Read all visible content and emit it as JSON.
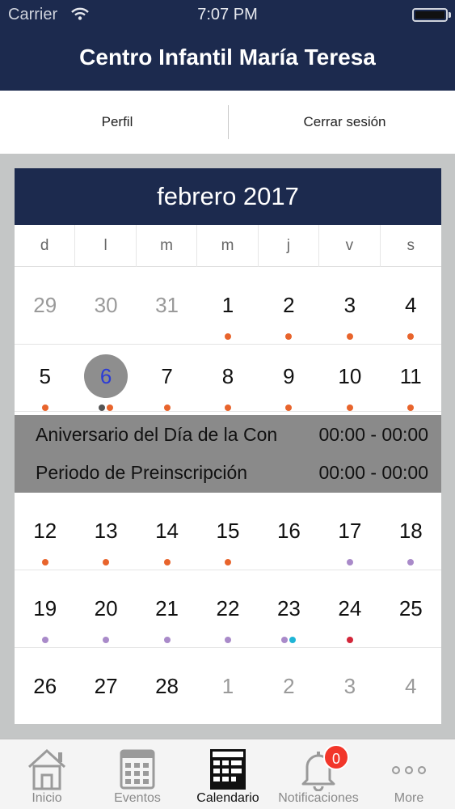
{
  "status_bar": {
    "carrier": "Carrier",
    "time": "7:07 PM"
  },
  "header": {
    "title": "Centro Infantil María Teresa"
  },
  "subnav": {
    "profile_label": "Perfil",
    "logout_label": "Cerrar sesión"
  },
  "calendar": {
    "month_title": "febrero 2017",
    "weekdays": [
      "d",
      "l",
      "m",
      "m",
      "j",
      "v",
      "s"
    ],
    "weeks": [
      [
        {
          "d": "29",
          "other": true,
          "dots": []
        },
        {
          "d": "30",
          "other": true,
          "dots": []
        },
        {
          "d": "31",
          "other": true,
          "dots": []
        },
        {
          "d": "1",
          "dots": [
            "#e8642c"
          ]
        },
        {
          "d": "2",
          "dots": [
            "#e8642c"
          ]
        },
        {
          "d": "3",
          "dots": [
            "#e8642c"
          ]
        },
        {
          "d": "4",
          "dots": [
            "#e8642c"
          ]
        }
      ],
      [
        {
          "d": "5",
          "dots": [
            "#e8642c"
          ]
        },
        {
          "d": "6",
          "today": true,
          "dots": [
            "#555555",
            "#e8642c"
          ]
        },
        {
          "d": "7",
          "dots": [
            "#e8642c"
          ]
        },
        {
          "d": "8",
          "dots": [
            "#e8642c"
          ]
        },
        {
          "d": "9",
          "dots": [
            "#e8642c"
          ]
        },
        {
          "d": "10",
          "dots": [
            "#e8642c"
          ]
        },
        {
          "d": "11",
          "dots": [
            "#e8642c"
          ]
        }
      ],
      [
        {
          "d": "12",
          "dots": [
            "#e8642c"
          ]
        },
        {
          "d": "13",
          "dots": [
            "#e8642c"
          ]
        },
        {
          "d": "14",
          "dots": [
            "#e8642c"
          ]
        },
        {
          "d": "15",
          "dots": [
            "#e8642c"
          ]
        },
        {
          "d": "16",
          "dots": []
        },
        {
          "d": "17",
          "dots": [
            "#a98ac9"
          ]
        },
        {
          "d": "18",
          "dots": [
            "#a98ac9"
          ]
        }
      ],
      [
        {
          "d": "19",
          "dots": [
            "#a98ac9"
          ]
        },
        {
          "d": "20",
          "dots": [
            "#a98ac9"
          ]
        },
        {
          "d": "21",
          "dots": [
            "#a98ac9"
          ]
        },
        {
          "d": "22",
          "dots": [
            "#a98ac9"
          ]
        },
        {
          "d": "23",
          "dots": [
            "#a98ac9",
            "#1fb5d6"
          ]
        },
        {
          "d": "24",
          "dots": [
            "#d3263a"
          ]
        },
        {
          "d": "25",
          "dots": []
        }
      ],
      [
        {
          "d": "26",
          "dots": []
        },
        {
          "d": "27",
          "dots": []
        },
        {
          "d": "28",
          "dots": []
        },
        {
          "d": "1",
          "other": true,
          "dots": []
        },
        {
          "d": "2",
          "other": true,
          "dots": []
        },
        {
          "d": "3",
          "other": true,
          "dots": []
        },
        {
          "d": "4",
          "other": true,
          "dots": []
        }
      ]
    ],
    "events": [
      {
        "name": "Aniversario del Día de la Con",
        "time": "00:00 - 00:00"
      },
      {
        "name": "Periodo de Preinscripción",
        "time": "00:00 - 00:00"
      }
    ]
  },
  "tabbar": {
    "tabs": [
      {
        "label": "Inicio",
        "icon": "home-icon"
      },
      {
        "label": "Eventos",
        "icon": "calendar-icon"
      },
      {
        "label": "Calendario",
        "icon": "calendar-grid-icon",
        "active": true
      },
      {
        "label": "Notificaciones",
        "icon": "bell-icon",
        "badge": "0"
      },
      {
        "label": "More",
        "icon": "more-icon"
      }
    ]
  },
  "colors": {
    "brand": "#1c2a4e",
    "badge": "#f2362a",
    "today_circle": "#8e8e8e",
    "event_band": "#8a8a8a"
  }
}
